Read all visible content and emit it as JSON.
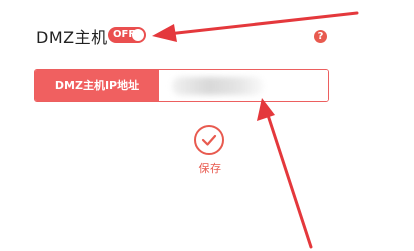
{
  "dmz": {
    "title": "DMZ主机",
    "toggle_label": "OFF",
    "help_glyph": "?"
  },
  "ip_field": {
    "label": "DMZ主机IP地址",
    "value": ""
  },
  "save": {
    "label": "保存"
  },
  "colors": {
    "accent": "#ea4f4f",
    "arrow": "#e4383c"
  },
  "icons": {
    "help": "help-icon",
    "save": "checkmark-icon"
  }
}
